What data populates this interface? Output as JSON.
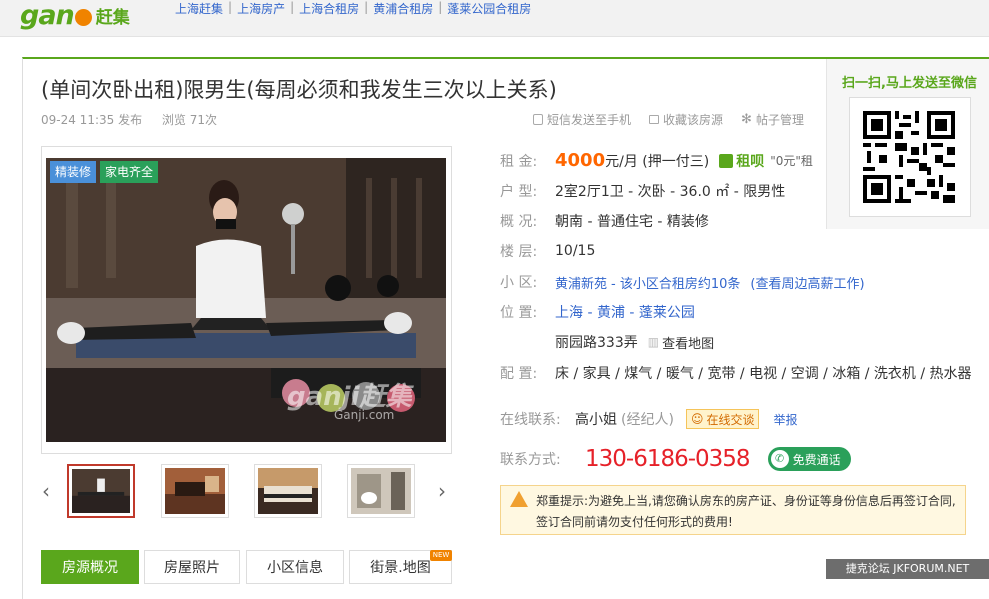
{
  "logo": {
    "text": "gan",
    "suffix": "ji",
    "brand_cn": "赶集"
  },
  "breadcrumbs": [
    "上海赶集",
    "上海房产",
    "上海合租房",
    "黄浦合租房",
    "蓬莱公园合租房"
  ],
  "breadcrumb_sep": "|",
  "listing": {
    "title": "(单间次卧出租)限男生(每周必须和我发生三次以上关系)",
    "posted": "09-24 11:35 发布",
    "views": "浏览  71次"
  },
  "tools": {
    "sms": "短信发送至手机",
    "favorite": "收藏该房源",
    "manage": "帖子管理"
  },
  "qr": {
    "title": "扫一扫,马上发送至微信"
  },
  "photo": {
    "badges": [
      "精装修",
      "家电齐全"
    ],
    "watermark": "ganji赶集",
    "watermark_url": "Ganji.com"
  },
  "thumbs": [
    "thumb-1",
    "thumb-2",
    "thumb-3",
    "thumb-4"
  ],
  "tabs": [
    "房源概况",
    "房屋照片",
    "小区信息",
    "街景.地图"
  ],
  "new_tag": "NEW",
  "info": {
    "rent_label": "租  金:",
    "rent_value": "4000",
    "rent_unit": "元/月 (押一付三)",
    "zu_brand": "租呗",
    "zu_text": "\"0元\"租",
    "type_label": "户  型:",
    "type_value": "2室2厅1卫 - 次卧 - 36.0 ㎡ - 限男性",
    "overview_label": "概  况:",
    "overview_value": "朝南 - 普通住宅 - 精装修",
    "floor_label": "楼  层:",
    "floor_value": "10/15",
    "community_label": "小  区:",
    "community_name": "黄浦新苑",
    "community_count": "- 该小区合租房约10条",
    "community_jobs": "(查看周边高薪工作)",
    "location_label": "位  置:",
    "location_value": "上海 - 黄浦 - 蓬莱公园",
    "address": "丽园路333弄",
    "map_link": "查看地图",
    "config_label": "配  置:",
    "config_value": "床 / 家具 / 煤气 / 暖气 / 宽带 / 电视 / 空调 / 冰箱 / 洗衣机 / 热水器"
  },
  "contact": {
    "online_label": "在线联系:",
    "name": "高小姐",
    "role": "(经纪人)",
    "chat": "在线交谈",
    "report": "举报",
    "method_label": "联系方式:",
    "phone": "130-6186-0358",
    "call": "免费通话"
  },
  "warning": {
    "title": "郑重提示:",
    "text": "为避免上当,请您确认房东的房产证、身份证等身份信息后再签订合同,签订合同前请勿支付任何形式的费用!"
  },
  "footer_watermark": "捷克论坛 JKFORUM.NET",
  "colors": {
    "green": "#5aa71c",
    "orange": "#f08300",
    "price": "#ff6600",
    "phone": "#e62129",
    "link": "#3366cc"
  }
}
